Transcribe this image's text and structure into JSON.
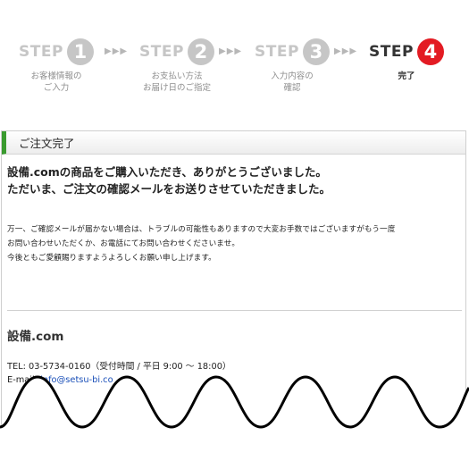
{
  "steps": [
    {
      "word": "STEP",
      "num": "1",
      "desc1": "お客様情報の",
      "desc2": "ご入力",
      "active": false
    },
    {
      "word": "STEP",
      "num": "2",
      "desc1": "お支払い方法",
      "desc2": "お届け日のご指定",
      "active": false
    },
    {
      "word": "STEP",
      "num": "3",
      "desc1": "入力内容の",
      "desc2": "確認",
      "active": false
    },
    {
      "word": "STEP",
      "num": "4",
      "desc1": "完了",
      "desc2": "",
      "active": true
    }
  ],
  "separator": "▶▶▶",
  "panel": {
    "title": "ご注文完了",
    "thanks_line1": "設備.comの商品をご購入いただき、ありがとうございました。",
    "thanks_line2": "ただいま、ご注文の確認メールをお送りさせていただきました。",
    "note_line1": "万一、ご確認メールが届かない場合は、トラブルの可能性もありますので大変お手数ではございますがもう一度",
    "note_line2": "お問い合わせいただくか、お電話にてお問い合わせくださいませ。",
    "note_line3": "今後ともご愛顧賜りますようよろしくお願い申し上げます。",
    "company": "設備.com",
    "tel": "TEL: 03-5734-0160（受付時間 / 平日 9:00 ～ 18:00）",
    "email_label": "E-mail: ",
    "email": "info@setsu-bi.co"
  },
  "colors": {
    "accent_red": "#e31b23",
    "inactive_gray": "#c6c6c6",
    "header_bar_green": "#3a9b2f",
    "link_blue": "#1a4fb8"
  }
}
